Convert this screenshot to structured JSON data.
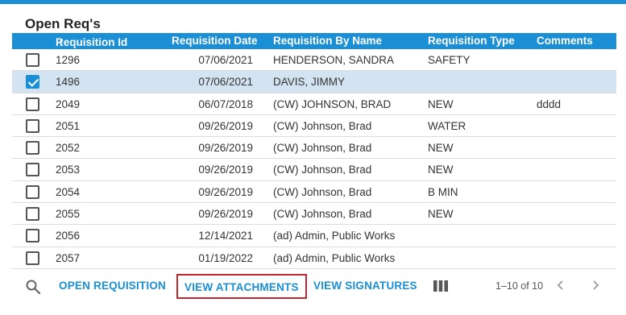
{
  "panel": {
    "title": "Open Req's"
  },
  "grid": {
    "columns": {
      "id": "Requisition Id",
      "date": "Requisition Date",
      "name": "Requisition By Name",
      "type": "Requisition Type",
      "comments": "Comments"
    },
    "sort_indicator": "↑",
    "rows": [
      {
        "checked": false,
        "id": "1296",
        "date": "07/06/2021",
        "name": "HENDERSON, SANDRA",
        "type": "SAFETY",
        "comments": ""
      },
      {
        "checked": true,
        "id": "1496",
        "date": "07/06/2021",
        "name": "DAVIS, JIMMY",
        "type": "",
        "comments": ""
      },
      {
        "checked": false,
        "id": "2049",
        "date": "06/07/2018",
        "name": "(CW) JOHNSON, BRAD",
        "type": "NEW",
        "comments": "dddd"
      },
      {
        "checked": false,
        "id": "2051",
        "date": "09/26/2019",
        "name": "(CW) Johnson, Brad",
        "type": "WATER",
        "comments": ""
      },
      {
        "checked": false,
        "id": "2052",
        "date": "09/26/2019",
        "name": "(CW) Johnson, Brad",
        "type": "NEW",
        "comments": ""
      },
      {
        "checked": false,
        "id": "2053",
        "date": "09/26/2019",
        "name": "(CW) Johnson, Brad",
        "type": "NEW",
        "comments": ""
      },
      {
        "checked": false,
        "id": "2054",
        "date": "09/26/2019",
        "name": "(CW) Johnson, Brad",
        "type": "B MIN",
        "comments": ""
      },
      {
        "checked": false,
        "id": "2055",
        "date": "09/26/2019",
        "name": "(CW) Johnson, Brad",
        "type": "NEW",
        "comments": ""
      },
      {
        "checked": false,
        "id": "2056",
        "date": "12/14/2021",
        "name": "(ad) Admin, Public Works",
        "type": "",
        "comments": ""
      },
      {
        "checked": false,
        "id": "2057",
        "date": "01/19/2022",
        "name": "(ad) Admin, Public Works",
        "type": "",
        "comments": ""
      }
    ]
  },
  "toolbar": {
    "search_icon": "search-icon",
    "open_requisition": "OPEN REQUISITION",
    "view_attachments": "VIEW ATTACHMENTS",
    "view_signatures": "VIEW SIGNATURES",
    "columns_icon": "columns-icon",
    "pager_text": "1–10 of 10"
  },
  "colors": {
    "accent": "#1a8fd6",
    "selected_row": "#d3e3f1",
    "highlight_border": "#c0282d"
  }
}
